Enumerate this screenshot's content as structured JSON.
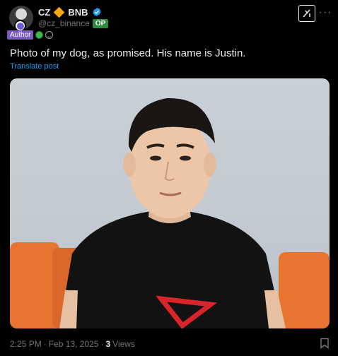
{
  "post": {
    "author": {
      "display_name": "CZ",
      "name_suffix": "BNB",
      "handle": "@cz_binance",
      "op_label": "OP",
      "author_label": "Author"
    },
    "text": "Photo of my dog, as promised. His name is Justin.",
    "translate_label": "Translate post",
    "meta": {
      "time": "2:25 PM",
      "separator": "·",
      "date": "Feb 13, 2025",
      "views_count": "3",
      "views_label": "Views"
    },
    "icons": {
      "grok": "grok-icon",
      "more": "more-icon",
      "verified": "verified-icon",
      "bookmark": "bookmark-icon"
    },
    "colors": {
      "background": "#000000",
      "link": "#1d9bf0",
      "op_badge": "#2e8b3d",
      "author_badge": "#7b5bbf",
      "diamond": "#f3a712",
      "muted_text": "#71767b"
    }
  }
}
